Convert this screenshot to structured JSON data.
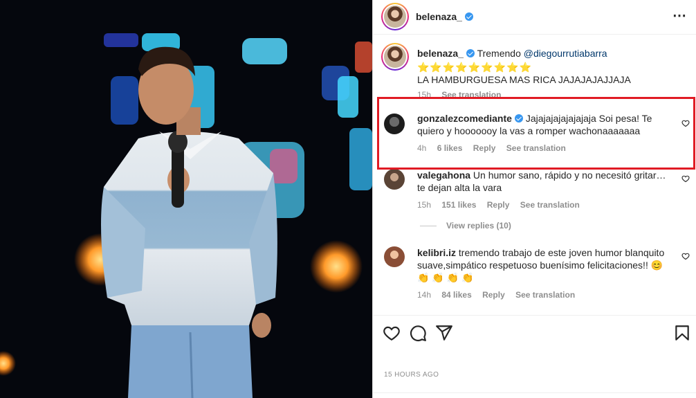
{
  "post": {
    "author": "belenaza_",
    "more_icon": "⋯",
    "timestamp": "15 HOURS AGO"
  },
  "caption": {
    "user": "belenaza_",
    "text": "Tremendo",
    "mention": "@diegourrutiabarra",
    "stars": "⭐⭐⭐⭐⭐⭐⭐⭐⭐",
    "line2": "LA HAMBURGUESA MAS RICA JAJAJAJAJJAJA",
    "time": "15h",
    "translate": "See translation"
  },
  "comments": [
    {
      "user": "gonzalezcomediante",
      "verified": true,
      "text": "Jajajajajajajajaja Soi pesa! Te quiero y hooooooy la vas a romper wachonaaaaaaa",
      "time": "4h",
      "likes": "6 likes",
      "reply": "Reply",
      "translate": "See translation",
      "highlighted": true
    },
    {
      "user": "valegahona",
      "verified": false,
      "text": "Un humor sano, rápido y no necesitó gritar… te dejan alta la vara",
      "time": "15h",
      "likes": "151 likes",
      "reply": "Reply",
      "translate": "See translation"
    },
    {
      "user": "kelibri.iz",
      "verified": false,
      "text": "tremendo trabajo de este joven humor blanquito suave,simpático respetuoso buenísimo felicitaciones!! 😊 👏 👏 👏 👏",
      "time": "14h",
      "likes": "84 likes",
      "reply": "Reply",
      "translate": "See translation"
    }
  ],
  "view_replies": "View replies (10)",
  "icons": {
    "like": "heart-icon",
    "comment": "comment-icon",
    "share": "send-icon",
    "save": "bookmark-icon"
  },
  "colors": {
    "highlight": "#e01b24",
    "verified": "#3897f0",
    "mention": "#00376b",
    "muted": "#8e8e8e"
  }
}
